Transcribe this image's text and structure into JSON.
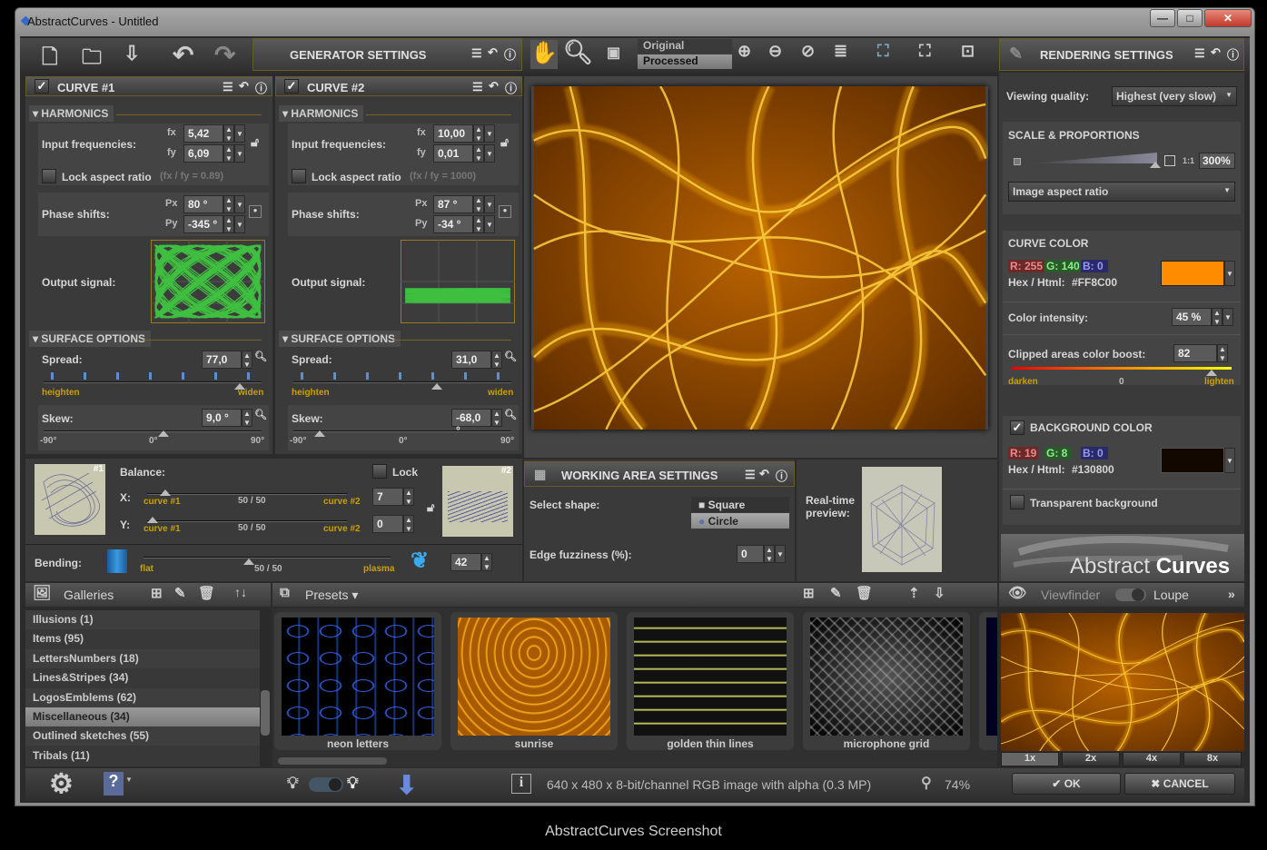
{
  "window": {
    "title": "AbstractCurves - Untitled",
    "caption": "AbstractCurves Screenshot",
    "minimize": "—",
    "maximize": "□",
    "close": "✕"
  },
  "toolbar": {
    "generator_title": "GENERATOR SETTINGS",
    "view_original": "Original",
    "view_processed": "Processed",
    "rendering_title": "RENDERING SETTINGS"
  },
  "curves": [
    {
      "title": "CURVE #1",
      "harmonics": "HARMONICS",
      "input_freq_label": "Input frequencies:",
      "fx_label": "fx",
      "fy_label": "fy",
      "fx": "5,42",
      "fy": "6,09",
      "lock_label": "Lock aspect ratio",
      "ratio": "(fx / fy = 0.89)",
      "phase_label": "Phase shifts:",
      "px_label": "Px",
      "py_label": "Py",
      "px": "80 °",
      "py": "-345 °",
      "output_label": "Output signal:",
      "surface": "SURFACE OPTIONS",
      "spread_label": "Spread:",
      "spread": "77,0",
      "spread_fraction": 0.9,
      "heighten": "heighten",
      "widen": "widen",
      "skew_label": "Skew:",
      "skew": "9,0 °",
      "skew_deg": 9,
      "skew_ticks": [
        "-90°",
        "0°",
        "90°"
      ],
      "fxv": 5.42,
      "fyv": 6.09,
      "pxv": 80,
      "pyv": -345
    },
    {
      "title": "CURVE #2",
      "harmonics": "HARMONICS",
      "input_freq_label": "Input frequencies:",
      "fx_label": "fx",
      "fy_label": "fy",
      "fx": "10,00",
      "fy": "0,01",
      "lock_label": "Lock aspect ratio",
      "ratio": "(fx / fy = 1000)",
      "phase_label": "Phase shifts:",
      "px_label": "Px",
      "py_label": "Py",
      "px": "87 °",
      "py": "-34 °",
      "output_label": "Output signal:",
      "surface": "SURFACE OPTIONS",
      "spread_label": "Spread:",
      "spread": "31,0",
      "spread_fraction": 0.66,
      "heighten": "heighten",
      "widen": "widen",
      "skew_label": "Skew:",
      "skew": "-68,0 °",
      "skew_deg": -68,
      "skew_ticks": [
        "-90°",
        "0°",
        "90°"
      ],
      "fxv": 10,
      "fyv": 0.01,
      "pxv": 87,
      "pyv": -34
    }
  ],
  "balance": {
    "label": "Balance:",
    "thumb1": "#1",
    "thumb2": "#2",
    "lock": "Lock",
    "x_label": "X:",
    "y_label": "Y:",
    "curve1": "curve #1",
    "mid": "50 / 50",
    "curve2": "curve #2",
    "x_value": "7",
    "y_value": "0",
    "bending_label": "Bending:",
    "flat": "flat",
    "plasma": "plasma",
    "bending_value": "42"
  },
  "working_area": {
    "title": "WORKING AREA SETTINGS",
    "select_shape": "Select shape:",
    "square": "Square",
    "circle": "Circle",
    "selected": "Circle",
    "edge_label": "Edge fuzziness (%):",
    "edge_value": "0",
    "realtime": "Real-time preview:"
  },
  "rendering": {
    "viewing_label": "Viewing quality:",
    "viewing_value": "Highest (very slow)",
    "scale_title": "SCALE & PROPORTIONS",
    "one_to_one": "1:1",
    "scale_value": "300%",
    "aspect": "Image aspect ratio",
    "curve_color_title": "CURVE COLOR",
    "curve_r": "R: 255",
    "curve_g": "G: 140",
    "curve_b": "B:    0",
    "hex_label": "Hex / Html:",
    "curve_hex": "#FF8C00",
    "curve_color": "#FF8C00",
    "intensity_label": "Color intensity:",
    "intensity": "45 %",
    "clipped_label": "Clipped areas color boost:",
    "clipped": "82",
    "darken": "darken",
    "zero": "0",
    "lighten": "lighten",
    "bg_title": "BACKGROUND COLOR",
    "bg_r": "R:  19",
    "bg_g": "G:    8",
    "bg_b": "B:    0",
    "bg_hex": "#130800",
    "bg_color": "#130800",
    "transparent": "Transparent background",
    "logo": "Abstract Curves"
  },
  "galleries": {
    "title": "Galleries",
    "items": [
      "Illusions (1)",
      "Items (95)",
      "LettersNumbers (18)",
      "Lines&Stripes (34)",
      "LogosEmblems (62)",
      "Miscellaneous (34)",
      "Outlined sketches (55)",
      "Tribals (11)"
    ],
    "selected": "Miscellaneous (34)"
  },
  "presets": {
    "title": "Presets",
    "items": [
      "neon letters",
      "sunrise",
      "golden thin lines",
      "microphone grid"
    ]
  },
  "viewfinder": {
    "title": "Viewfinder",
    "loupe": "Loupe",
    "zooms": [
      "1x",
      "2x",
      "4x",
      "8x"
    ],
    "ok": "OK",
    "cancel": "CANCEL"
  },
  "status": {
    "info": "640 x 480 x 8-bit/channel RGB image with alpha  (0.3 MP)",
    "zoom": "74%"
  }
}
